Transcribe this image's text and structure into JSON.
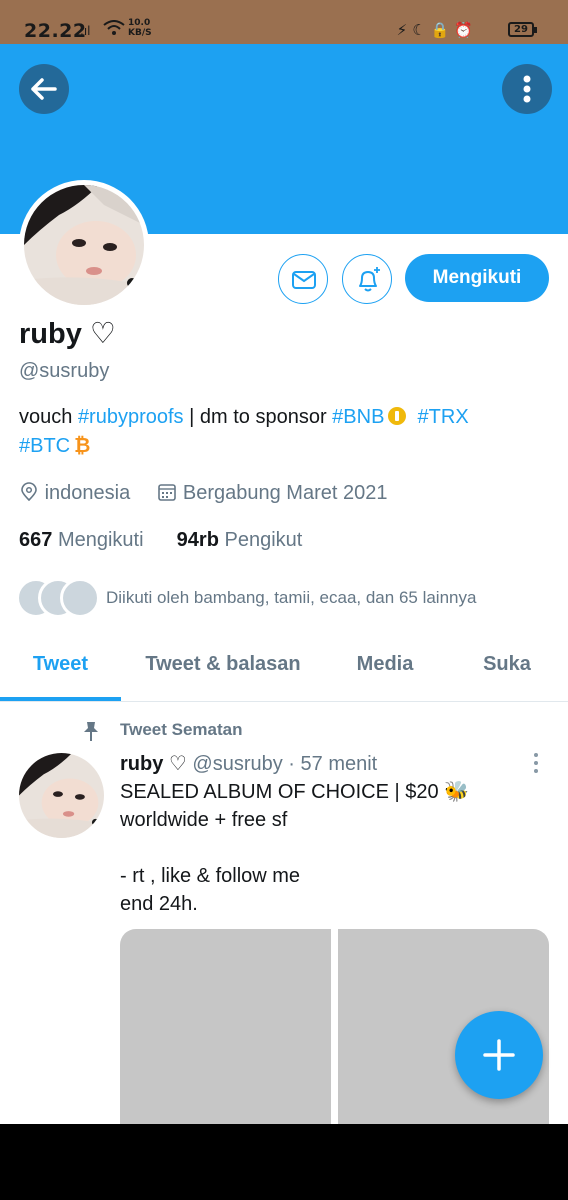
{
  "status_bar": {
    "time": "22.22",
    "signal": ".ıl",
    "speed_value": "10.0",
    "speed_unit": "KB/S",
    "icons": "⚡☾🔒⏰",
    "battery": "29"
  },
  "header": {
    "back_icon": "back-arrow-icon",
    "more_icon": "vertical-dots-icon",
    "banner_color": "#1da1f2"
  },
  "profile": {
    "name": "ruby ♡",
    "handle": "@susruby",
    "bio": {
      "part1": "vouch ",
      "tag1": "#rubyproofs",
      "part2": " | dm to sponsor ",
      "tag2": "#BNB",
      "tag3": "#TRX",
      "tag4": "#BTC",
      "btc_symbol": "₿"
    },
    "location": "indonesia",
    "joined": "Bergabung Maret 2021",
    "following_count": "667",
    "following_label": "Mengikuti",
    "followers_count": "94rb",
    "followers_label": "Pengikut",
    "followed_by": "Diikuti oleh bambang, tamii, ecaa, dan 65 lainnya",
    "follow_button": "Mengikuti"
  },
  "tabs": [
    {
      "label": "Tweet",
      "active": true
    },
    {
      "label": "Tweet & balasan",
      "active": false
    },
    {
      "label": "Media",
      "active": false
    },
    {
      "label": "Suka",
      "active": false
    }
  ],
  "pinned": {
    "label": "Tweet Sematan",
    "author": "ruby ♡",
    "handle": "@susruby",
    "time": "· 57 menit",
    "text": "SEALED ALBUM OF CHOICE | $20 🐝\nworldwide + free sf\n\n- rt , like & follow me\nend 24h."
  },
  "colors": {
    "accent": "#1da1f2",
    "secondary_text": "#657786",
    "status_bar": "#9a7050"
  }
}
